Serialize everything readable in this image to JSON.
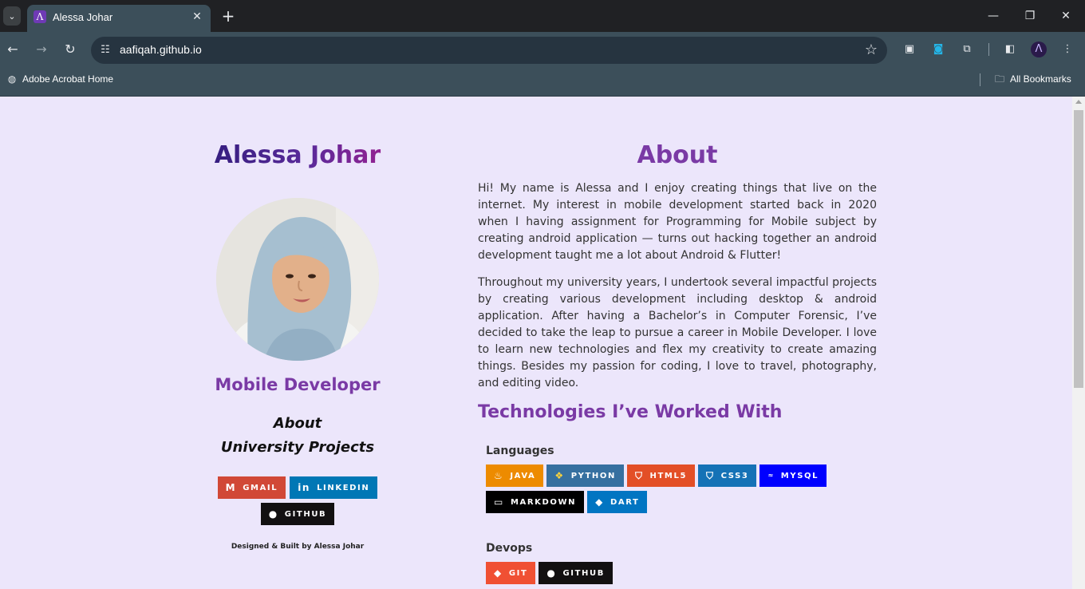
{
  "browser": {
    "tab_title": "Alessa Johar",
    "url": "aafiqah.github.io",
    "bookmarks": [
      {
        "label": "Adobe Acrobat Home"
      },
      {
        "label": "All Bookmarks"
      }
    ]
  },
  "profile": {
    "name": "Alessa Johar",
    "role": "Mobile Developer",
    "nav": [
      "About",
      "University Projects"
    ],
    "contact_badges": [
      {
        "label": "GMAIL",
        "color": "#d14836",
        "icon": "gmail-icon"
      },
      {
        "label": "LINKEDIN",
        "color": "#0077b5",
        "icon": "linkedin-icon"
      },
      {
        "label": "GITHUB",
        "color": "#121011",
        "icon": "github-icon"
      }
    ],
    "credit": "Designed & Built by Alessa Johar"
  },
  "about": {
    "title": "About",
    "paragraphs": [
      "Hi! My name is Alessa and I enjoy creating things that live on the internet. My interest in mobile development started back in 2020 when I having assignment for Programming for Mobile subject by creating android application — turns out hacking together an android development taught me a lot about Android & Flutter!",
      "Throughout my university years, I undertook several impactful projects by creating various development including desktop & android application. After having a Bachelor’s in Computer Forensic, I’ve decided to take the leap to pursue a career in Mobile Developer. I love to learn new technologies and flex my creativity to create amazing things. Besides my passion for coding, I love to travel, photography, and editing video."
    ],
    "tech_title": "Technologies I’ve Worked With",
    "languages_label": "Languages",
    "languages": [
      {
        "label": "JAVA",
        "color": "#ed8b00",
        "icon": "java-icon"
      },
      {
        "label": "PYTHON",
        "color": "#3670a0",
        "icon": "python-icon"
      },
      {
        "label": "HTML5",
        "color": "#e34f26",
        "icon": "html5-icon"
      },
      {
        "label": "CSS3",
        "color": "#1572b6",
        "icon": "css3-icon"
      },
      {
        "label": "MYSQL",
        "color": "#0000ff",
        "icon": "mysql-icon"
      },
      {
        "label": "MARKDOWN",
        "color": "#000000",
        "icon": "markdown-icon"
      },
      {
        "label": "DART",
        "color": "#0175c2",
        "icon": "dart-icon"
      }
    ],
    "devops_label": "Devops",
    "devops": [
      {
        "label": "GIT",
        "color": "#f05033",
        "icon": "git-icon"
      },
      {
        "label": "GITHUB",
        "color": "#121011",
        "icon": "github-icon"
      }
    ]
  }
}
